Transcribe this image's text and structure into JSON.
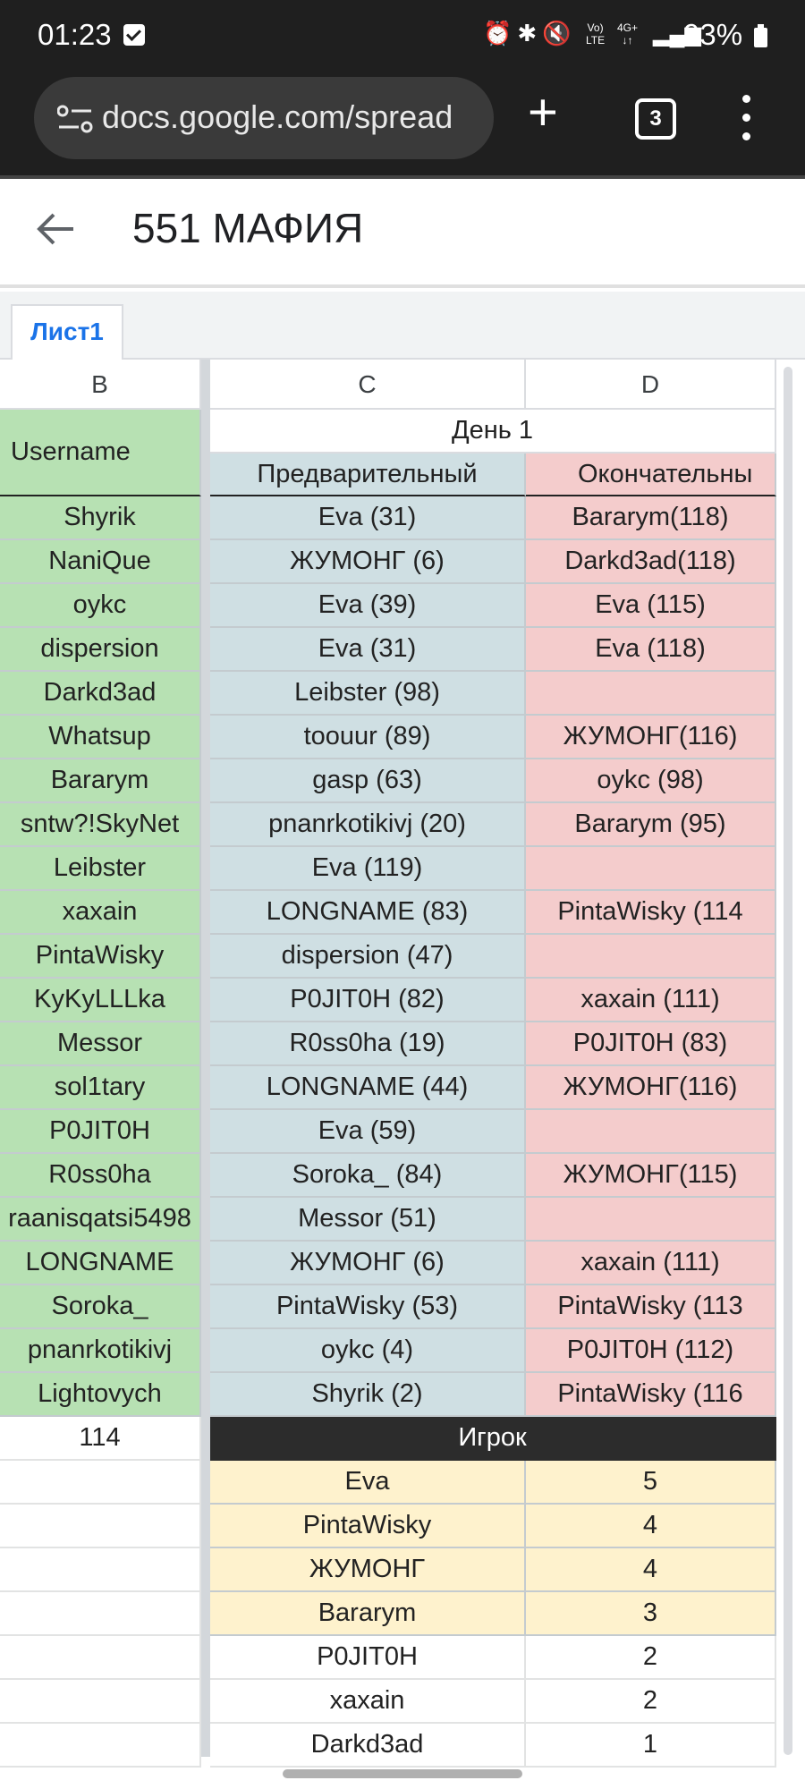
{
  "status_bar": {
    "time": "01:23",
    "lte_top": "Vo)",
    "lte_bottom": "LTE",
    "net_top": "4G+",
    "net_bottom": "↓↑",
    "battery": "93%"
  },
  "browser": {
    "url": "docs.google.com/spread",
    "new_tab_icon": "+",
    "tab_count": "3"
  },
  "doc": {
    "title": "551 МАФИЯ",
    "sheet_tab": "Лист1"
  },
  "columns": [
    "B",
    "C",
    "D"
  ],
  "sheet": {
    "day_header": "День 1",
    "username_header": "Username",
    "prelim_header": "Предварительный",
    "final_header": "Окончательны",
    "rows": [
      {
        "user": "Shyrik",
        "prelim": "Eva (31)",
        "final": "Bararym(118)"
      },
      {
        "user": "NaniQue",
        "prelim": "ЖУМОНГ (6)",
        "final": "Darkd3ad(118)"
      },
      {
        "user": "oykc",
        "prelim": "Eva (39)",
        "final": "Eva (115)"
      },
      {
        "user": "dispersion",
        "prelim": "Eva (31)",
        "final": "Eva (118)"
      },
      {
        "user": "Darkd3ad",
        "prelim": "Leibster (98)",
        "final": ""
      },
      {
        "user": "Whatsup",
        "prelim": "toouur (89)",
        "final": "ЖУМОНГ(116)"
      },
      {
        "user": "Bararym",
        "prelim": "gasp (63)",
        "final": "oykc (98)"
      },
      {
        "user": "sntw?!SkyNet",
        "prelim": "pnanrkotikivj (20)",
        "final": "Bararym (95)"
      },
      {
        "user": "Leibster",
        "prelim": "Eva (119)",
        "final": ""
      },
      {
        "user": "xaxain",
        "prelim": "LONGNAME (83)",
        "final": "PintaWisky (114"
      },
      {
        "user": "PintaWisky",
        "prelim": "dispersion (47)",
        "final": ""
      },
      {
        "user": "KyKyLLLka",
        "prelim": "P0JIT0H (82)",
        "final": "xaxain (111)"
      },
      {
        "user": "Messor",
        "prelim": "R0ss0ha (19)",
        "final": "P0JIT0H (83)"
      },
      {
        "user": "sol1tary",
        "prelim": "LONGNAME (44)",
        "final": "ЖУМОНГ(116)"
      },
      {
        "user": "P0JIT0H",
        "prelim": "Eva (59)",
        "final": ""
      },
      {
        "user": "R0ss0ha",
        "prelim": "Soroka_ (84)",
        "final": "ЖУМОНГ(115)"
      },
      {
        "user": "raanisqatsi5498",
        "prelim": "Messor (51)",
        "final": ""
      },
      {
        "user": "LONGNAME",
        "prelim": "ЖУМОНГ (6)",
        "final": "xaxain (111)"
      },
      {
        "user": "Soroka_",
        "prelim": "PintaWisky (53)",
        "final": "PintaWisky (113"
      },
      {
        "user": "pnanrkotikivj",
        "prelim": "oykc (4)",
        "final": "P0JIT0H (112)"
      },
      {
        "user": "Lightovych",
        "prelim": "Shyrik (2)",
        "final": "PintaWisky (116"
      }
    ],
    "total": "114",
    "player_header": "Игрок",
    "tally": [
      {
        "player": "Eva",
        "count": "5",
        "highlight": true
      },
      {
        "player": "PintaWisky",
        "count": "4",
        "highlight": true
      },
      {
        "player": "ЖУМОНГ",
        "count": "4",
        "highlight": true
      },
      {
        "player": "Bararym",
        "count": "3",
        "highlight": true
      },
      {
        "player": "P0JIT0H",
        "count": "2",
        "highlight": false
      },
      {
        "player": "xaxain",
        "count": "2",
        "highlight": false
      },
      {
        "player": "Darkd3ad",
        "count": "1",
        "highlight": false
      }
    ]
  },
  "colors": {
    "username_fill": "#b7e1b3",
    "prelim_fill": "#cfdfe3",
    "final_fill": "#f4cccc",
    "tally_fill": "#fef2cd",
    "player_header_fill": "#2c2c2c",
    "sheet_tab_text": "#1a73e8"
  },
  "icons": {
    "site": "site-settings-icon",
    "new_tab": "plus-icon",
    "tabs": "tab-switcher-icon",
    "menu": "more-vert-icon",
    "back": "back-arrow-icon"
  }
}
